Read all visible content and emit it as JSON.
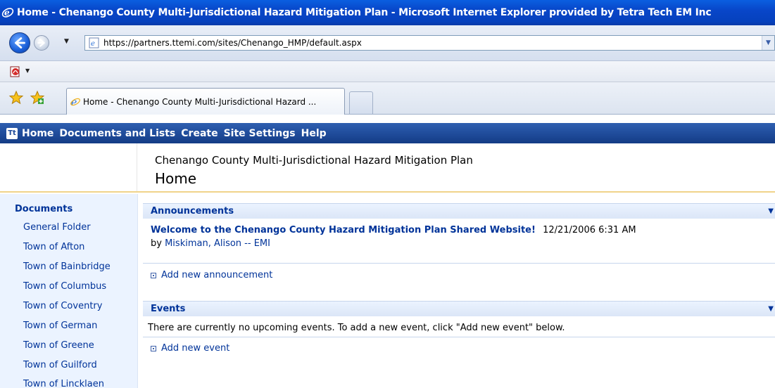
{
  "window": {
    "title": "Home - Chenango County Multi-Jurisdictional Hazard Mitigation Plan - Microsoft Internet Explorer provided by Tetra Tech EM Inc"
  },
  "address": {
    "url": "https://partners.ttemi.com/sites/Chenango_HMP/default.aspx"
  },
  "tabs": [
    {
      "label": "Home - Chenango County Multi-Jurisdictional Hazard ..."
    }
  ],
  "topnav": {
    "logo": "Tt",
    "items": [
      "Home",
      "Documents and Lists",
      "Create",
      "Site Settings",
      "Help"
    ]
  },
  "header": {
    "site_title": "Chenango County Multi-Jurisdictional Hazard Mitigation Plan",
    "page_title": "Home"
  },
  "leftnav": {
    "heading": "Documents",
    "items": [
      "General Folder",
      "Town of Afton",
      "Town of Bainbridge",
      "Town of Columbus",
      "Town of Coventry",
      "Town of German",
      "Town of Greene",
      "Town of Guilford",
      "Town of Lincklaen"
    ]
  },
  "announcements": {
    "title": "Announcements",
    "item_title": "Welcome to the Chenango County Hazard Mitigation Plan Shared Website!",
    "item_date": "12/21/2006 6:31 AM",
    "by_prefix": "by",
    "author": "Miskiman, Alison -- EMI",
    "add_label": "Add new announcement"
  },
  "events": {
    "title": "Events",
    "empty_text": "There are currently no upcoming events. To add a new event, click \"Add new event\" below.",
    "add_label": "Add new event"
  },
  "icons": {
    "browser": "ie-icon",
    "back": "back-arrow-icon",
    "forward": "forward-arrow-icon",
    "acrobat": "acrobat-icon",
    "favorites": "favorites-star-icon",
    "add_favorite": "add-favorite-icon",
    "webpart_menu": "chevron-down-icon",
    "add_bullet": "add-bullet-icon"
  },
  "colors": {
    "title_bar": "#0846c9",
    "topnav": "#1f4b9a",
    "link": "#003399",
    "leftnav_bg": "#ebf3ff",
    "header_rule": "#f0d38a"
  }
}
